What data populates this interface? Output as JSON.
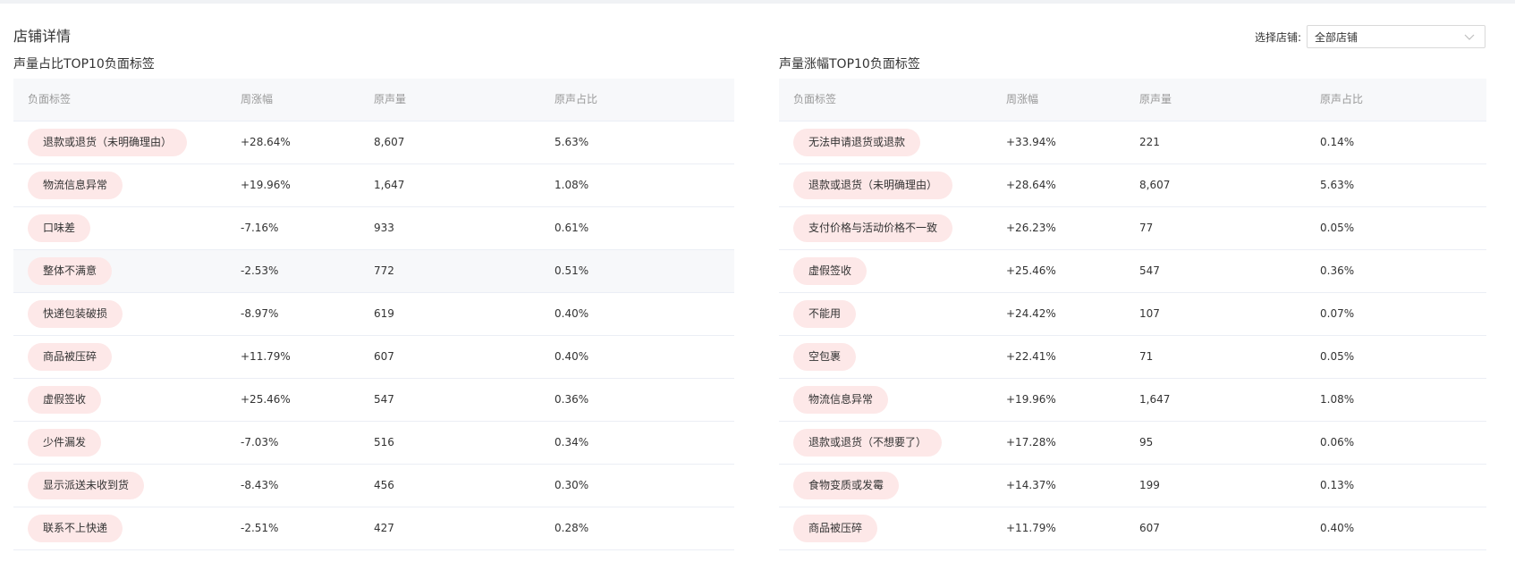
{
  "page": {
    "title": "店铺详情",
    "store_label": "选择店铺:",
    "store_value": "全部店铺"
  },
  "colors": {
    "tag_bg": "#fde8e8",
    "header_bg": "#f7f8fa",
    "divider": "#ebeef5"
  },
  "left_table": {
    "title": "声量占比TOP10负面标签",
    "headers": [
      "负面标签",
      "周涨幅",
      "原声量",
      "原声占比"
    ],
    "rows": [
      {
        "tag": "退款或退货（未明确理由）",
        "change": "+28.64%",
        "volume": "8,607",
        "ratio": "5.63%"
      },
      {
        "tag": "物流信息异常",
        "change": "+19.96%",
        "volume": "1,647",
        "ratio": "1.08%"
      },
      {
        "tag": "口味差",
        "change": "-7.16%",
        "volume": "933",
        "ratio": "0.61%"
      },
      {
        "tag": "整体不满意",
        "change": "-2.53%",
        "volume": "772",
        "ratio": "0.51%"
      },
      {
        "tag": "快递包装破损",
        "change": "-8.97%",
        "volume": "619",
        "ratio": "0.40%"
      },
      {
        "tag": "商品被压碎",
        "change": "+11.79%",
        "volume": "607",
        "ratio": "0.40%"
      },
      {
        "tag": "虚假签收",
        "change": "+25.46%",
        "volume": "547",
        "ratio": "0.36%"
      },
      {
        "tag": "少件漏发",
        "change": "-7.03%",
        "volume": "516",
        "ratio": "0.34%"
      },
      {
        "tag": "显示派送未收到货",
        "change": "-8.43%",
        "volume": "456",
        "ratio": "0.30%"
      },
      {
        "tag": "联系不上快递",
        "change": "-2.51%",
        "volume": "427",
        "ratio": "0.28%"
      }
    ]
  },
  "right_table": {
    "title": "声量涨幅TOP10负面标签",
    "headers": [
      "负面标签",
      "周涨幅",
      "原声量",
      "原声占比"
    ],
    "rows": [
      {
        "tag": "无法申请退货或退款",
        "change": "+33.94%",
        "volume": "221",
        "ratio": "0.14%"
      },
      {
        "tag": "退款或退货（未明确理由）",
        "change": "+28.64%",
        "volume": "8,607",
        "ratio": "5.63%"
      },
      {
        "tag": "支付价格与活动价格不一致",
        "change": "+26.23%",
        "volume": "77",
        "ratio": "0.05%"
      },
      {
        "tag": "虚假签收",
        "change": "+25.46%",
        "volume": "547",
        "ratio": "0.36%"
      },
      {
        "tag": "不能用",
        "change": "+24.42%",
        "volume": "107",
        "ratio": "0.07%"
      },
      {
        "tag": "空包裹",
        "change": "+22.41%",
        "volume": "71",
        "ratio": "0.05%"
      },
      {
        "tag": "物流信息异常",
        "change": "+19.96%",
        "volume": "1,647",
        "ratio": "1.08%"
      },
      {
        "tag": "退款或退货（不想要了）",
        "change": "+17.28%",
        "volume": "95",
        "ratio": "0.06%"
      },
      {
        "tag": "食物变质或发霉",
        "change": "+14.37%",
        "volume": "199",
        "ratio": "0.13%"
      },
      {
        "tag": "商品被压碎",
        "change": "+11.79%",
        "volume": "607",
        "ratio": "0.40%"
      }
    ]
  }
}
